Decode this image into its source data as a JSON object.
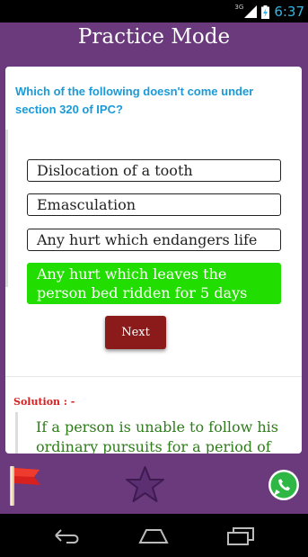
{
  "status_bar": {
    "network": "3G",
    "time": "6:37"
  },
  "header": {
    "title": "Practice Mode"
  },
  "question": {
    "text": "Which of the following doesn't come under section 320 of IPC?"
  },
  "options": [
    {
      "label": "Dislocation of a tooth",
      "state": "default"
    },
    {
      "label": "Emasculation",
      "state": "default"
    },
    {
      "label": "Any hurt which endangers life",
      "state": "default"
    },
    {
      "label": "Any hurt which leaves the person bed ridden for 5 days",
      "state": "correct"
    }
  ],
  "next_button": {
    "label": "Next"
  },
  "solution": {
    "label": "Solution : -",
    "text": "If a person is unable to follow his ordinary pursuits for a period of"
  },
  "bottom_bar": {
    "icons": [
      "flag-icon",
      "star-icon",
      "whatsapp-icon"
    ]
  },
  "nav_bar": {
    "icons": [
      "back-icon",
      "home-icon",
      "recent-apps-icon"
    ]
  },
  "colors": {
    "header_bg": "#6a3a7c",
    "question_text": "#1a9ad6",
    "correct_option": "#22dd00",
    "next_button": "#8b1a1a",
    "solution_label": "#d42020",
    "solution_text": "#2e7d1a"
  }
}
